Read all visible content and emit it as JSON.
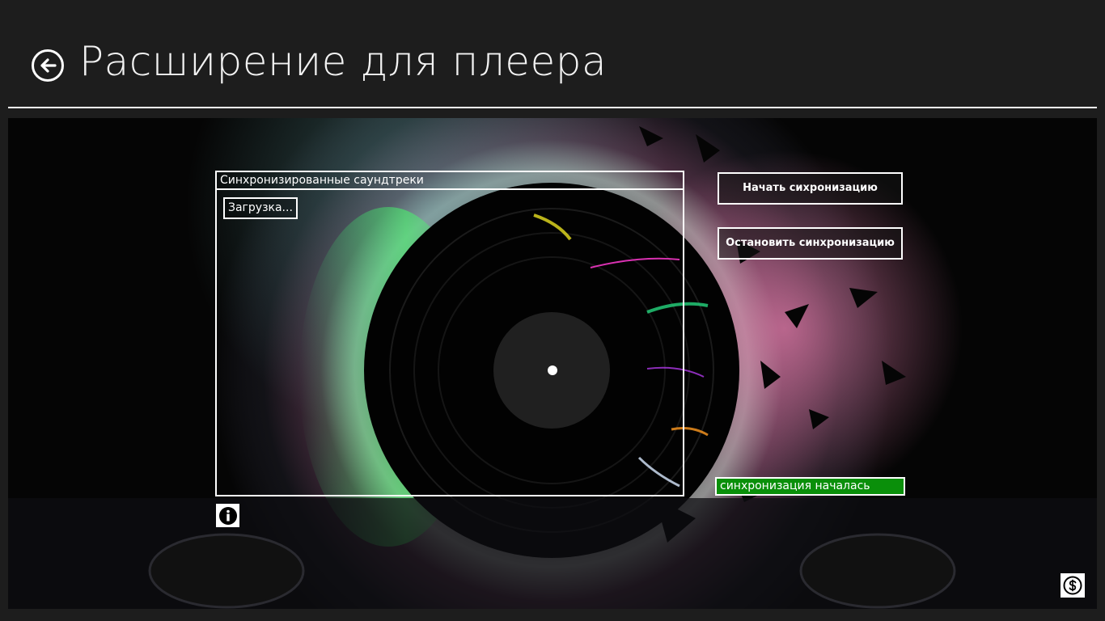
{
  "header": {
    "title": "Расширение для плеера",
    "back_icon": "back-arrow-circle-icon"
  },
  "tracks_panel": {
    "title": "Синхронизированные саундтреки",
    "loading_text": "Загрузка..."
  },
  "actions": {
    "start_label": "Начать сихронизацию",
    "stop_label": "Остановить синхронизацию"
  },
  "status": {
    "text": "синхронизация началась",
    "color": "#0a8f0a"
  },
  "icons": {
    "info": "info-icon",
    "donate": "dollar-icon"
  },
  "colors": {
    "background": "#1d1d1d",
    "accent": "#ffffff"
  }
}
